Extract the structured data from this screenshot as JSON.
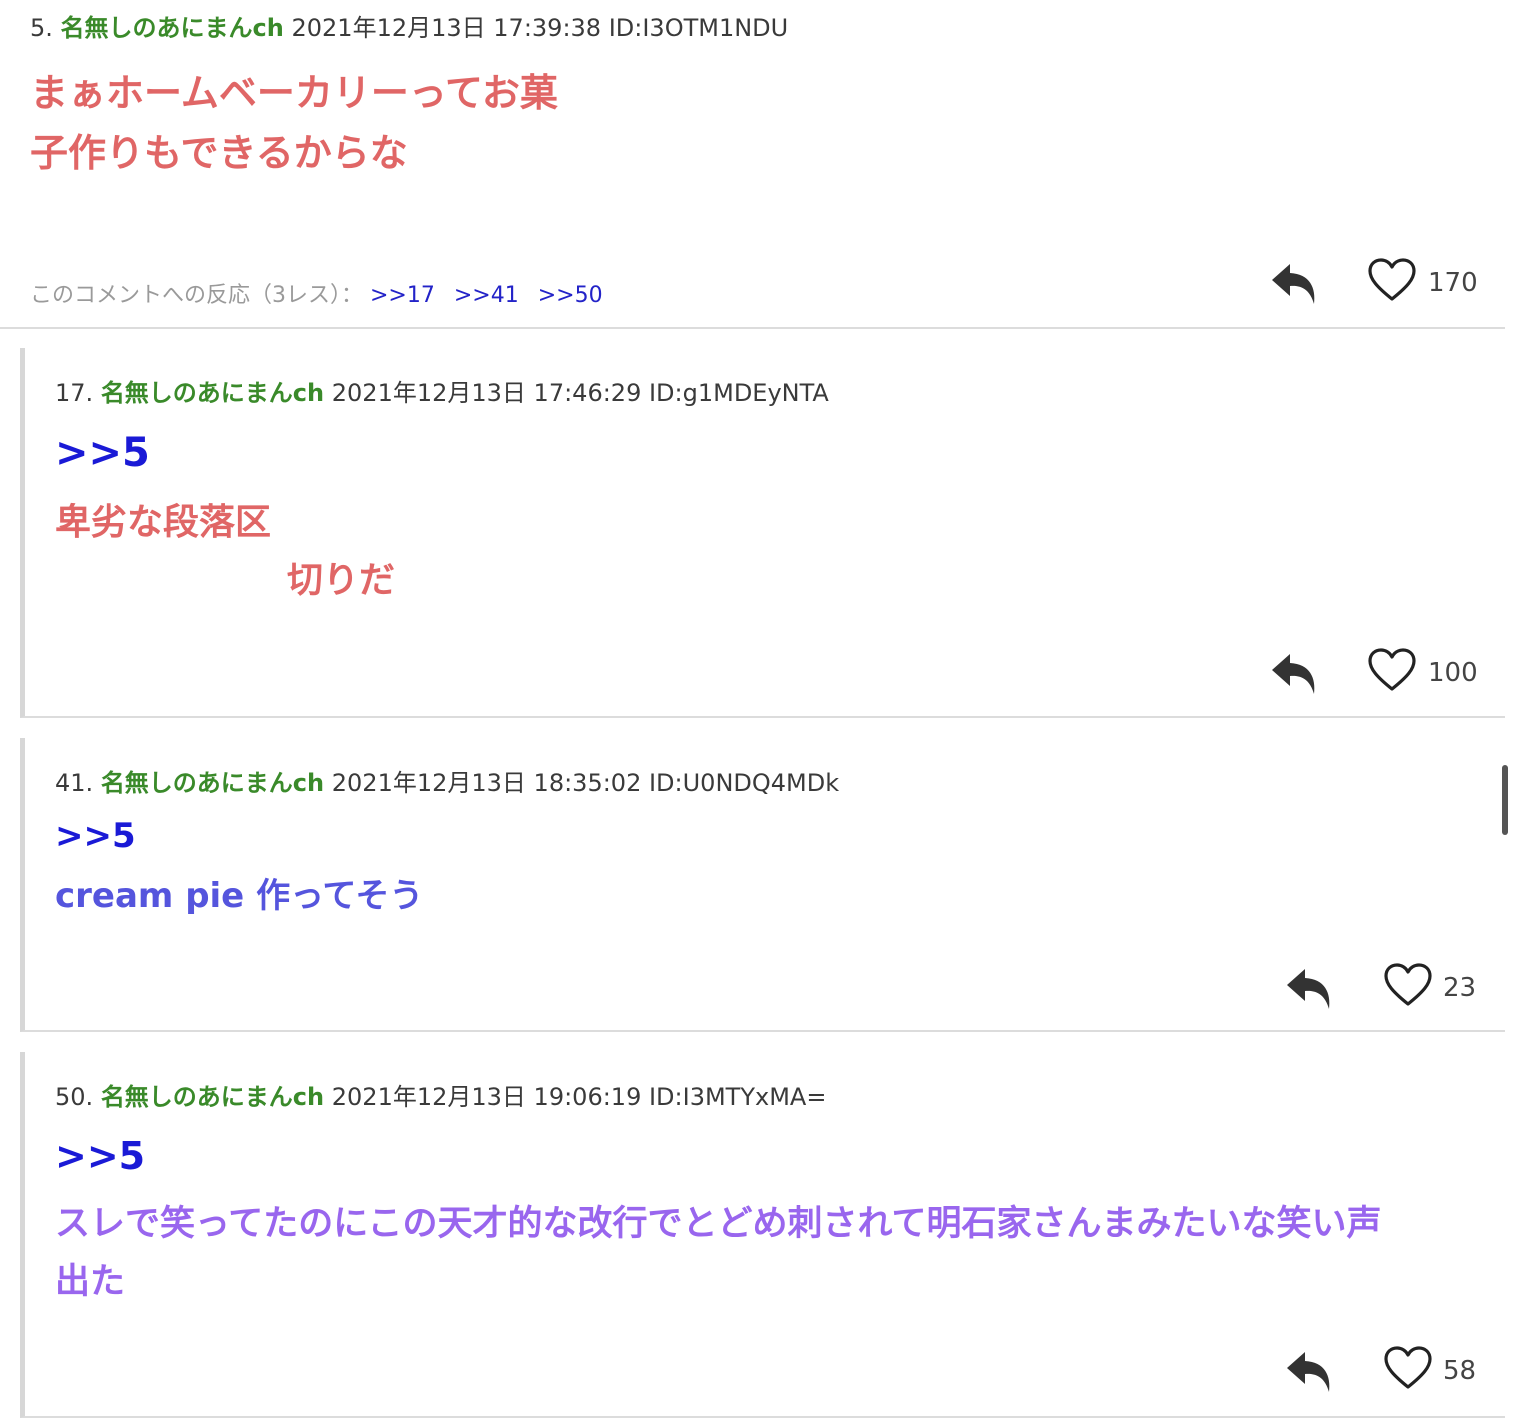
{
  "colors": {
    "name": "#3a8a2a",
    "anchor": "#1a1ad6",
    "red_text": "#e06666",
    "blue_text": "#5555dd",
    "purple_text": "#9966ee",
    "reaction_link": "#2323c8"
  },
  "posts": [
    {
      "number": "5.",
      "name": "名無しのあにまんch",
      "datetime": "2021年12月13日 17:39:38 ID:I3OTM1NDU",
      "lines": [
        "まぁホームベーカリーってお菓",
        "子作りもできるからな"
      ],
      "reactions_label": "このコメントへの反応（3レス）：",
      "reaction_links": [
        ">>17",
        ">>41",
        ">>50"
      ],
      "likes": "170"
    },
    {
      "number": "17.",
      "name": "名無しのあにまんch",
      "datetime": "2021年12月13日 17:46:29 ID:g1MDEyNTA",
      "anchor": ">>5",
      "lines": [
        "卑劣な段落区",
        "切りだ"
      ],
      "likes": "100"
    },
    {
      "number": "41.",
      "name": "名無しのあにまんch",
      "datetime": "2021年12月13日 18:35:02 ID:U0NDQ4MDk",
      "anchor": ">>5",
      "lines": [
        "cream pie 作ってそう"
      ],
      "likes": "23"
    },
    {
      "number": "50.",
      "name": "名無しのあにまんch",
      "datetime": "2021年12月13日 19:06:19 ID:I3MTYxMA=",
      "anchor": ">>5",
      "lines": [
        "スレで笑ってたのにこの天才的な改行でとどめ刺されて明石家さんまみたいな笑い声",
        "出た"
      ],
      "likes": "58"
    }
  ]
}
